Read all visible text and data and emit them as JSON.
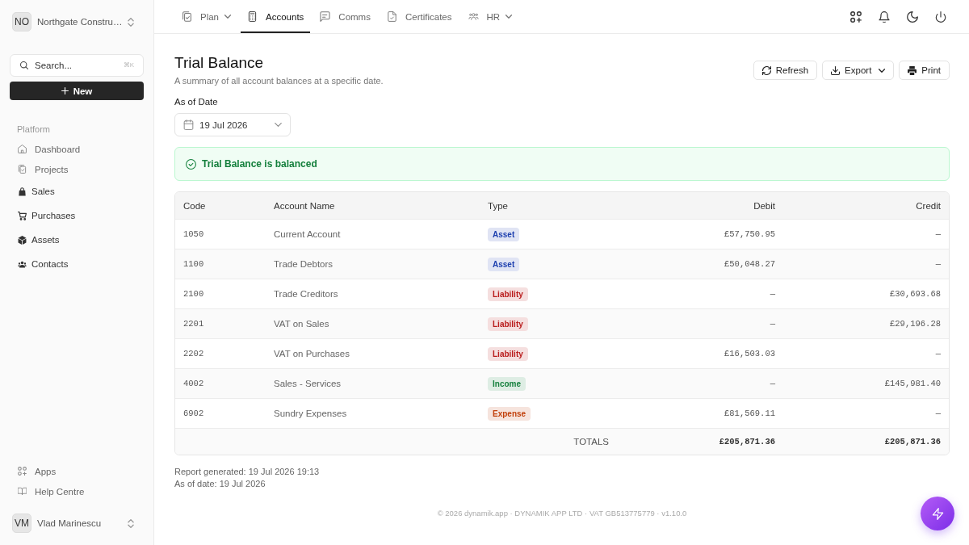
{
  "workspace": {
    "initials": "NO",
    "name": "Northgate Constru…"
  },
  "search": {
    "placeholder": "Search...",
    "shortcut": "⌘K"
  },
  "new_button": {
    "label": "New"
  },
  "sidebar": {
    "section": "Platform",
    "items": [
      {
        "label": "Dashboard",
        "kind": "outline"
      },
      {
        "label": "Projects",
        "kind": "outline"
      },
      {
        "label": "Sales",
        "kind": "filled"
      },
      {
        "label": "Purchases",
        "kind": "filled"
      },
      {
        "label": "Assets",
        "kind": "filled"
      },
      {
        "label": "Contacts",
        "kind": "filled"
      }
    ],
    "footer_items": [
      {
        "label": "Apps",
        "kind": "outline"
      },
      {
        "label": "Help Centre",
        "kind": "outline"
      }
    ]
  },
  "user": {
    "initials": "VM",
    "name": "Vlad Marinescu"
  },
  "nav": {
    "tabs": [
      {
        "label": "Plan",
        "selected": false,
        "dropdown": true
      },
      {
        "label": "Accounts",
        "selected": true,
        "dropdown": false
      },
      {
        "label": "Comms",
        "selected": false,
        "dropdown": false
      },
      {
        "label": "Certificates",
        "selected": false,
        "dropdown": false
      },
      {
        "label": "HR",
        "selected": false,
        "dropdown": true
      }
    ]
  },
  "page": {
    "title": "Trial Balance",
    "subtitle": "A summary of all account balances at a specific date.",
    "actions": [
      {
        "label": "Refresh",
        "dropdown": false
      },
      {
        "label": "Export",
        "dropdown": true
      },
      {
        "label": "Print",
        "dropdown": false
      }
    ]
  },
  "date_filter": {
    "label": "As of Date",
    "value": "19 Jul 2026"
  },
  "alert": {
    "kind": "success",
    "message": "Trial Balance is balanced"
  },
  "table": {
    "columns": [
      "Code",
      "Account Name",
      "Type",
      "Debit",
      "Credit"
    ],
    "rows": [
      {
        "code": "1050",
        "account_name": "Current Account",
        "type": {
          "label": "Asset",
          "color": "#1e40af"
        },
        "debit": "£57,750.95",
        "credit": "—"
      },
      {
        "code": "1100",
        "account_name": "Trade Debtors",
        "type": {
          "label": "Asset",
          "color": "#1e40af"
        },
        "debit": "£50,048.27",
        "credit": "—"
      },
      {
        "code": "2100",
        "account_name": "Trade Creditors",
        "type": {
          "label": "Liability",
          "color": "#b91c1c"
        },
        "debit": "—",
        "credit": "£30,693.68"
      },
      {
        "code": "2201",
        "account_name": "VAT on Sales",
        "type": {
          "label": "Liability",
          "color": "#b91c1c"
        },
        "debit": "—",
        "credit": "£29,196.28"
      },
      {
        "code": "2202",
        "account_name": "VAT on Purchases",
        "type": {
          "label": "Liability",
          "color": "#b91c1c"
        },
        "debit": "£16,503.03",
        "credit": "—"
      },
      {
        "code": "4002",
        "account_name": "Sales - Services",
        "type": {
          "label": "Income",
          "color": "#15803d"
        },
        "debit": "—",
        "credit": "£145,981.40"
      },
      {
        "code": "6902",
        "account_name": "Sundry Expenses",
        "type": {
          "label": "Expense",
          "color": "#c2410c"
        },
        "debit": "£81,569.11",
        "credit": "—"
      }
    ],
    "totals": {
      "label": "TOTALS",
      "debit": "£205,871.36",
      "credit": "£205,871.36"
    }
  },
  "report_info": [
    "Report generated: 19 Jul 2026 19:13",
    "As of date: 19 Jul 2026"
  ],
  "footer": "© 2026 dynamik.app · DYNAMIK APP LTD · VAT GB513775779 · v1.10.0"
}
